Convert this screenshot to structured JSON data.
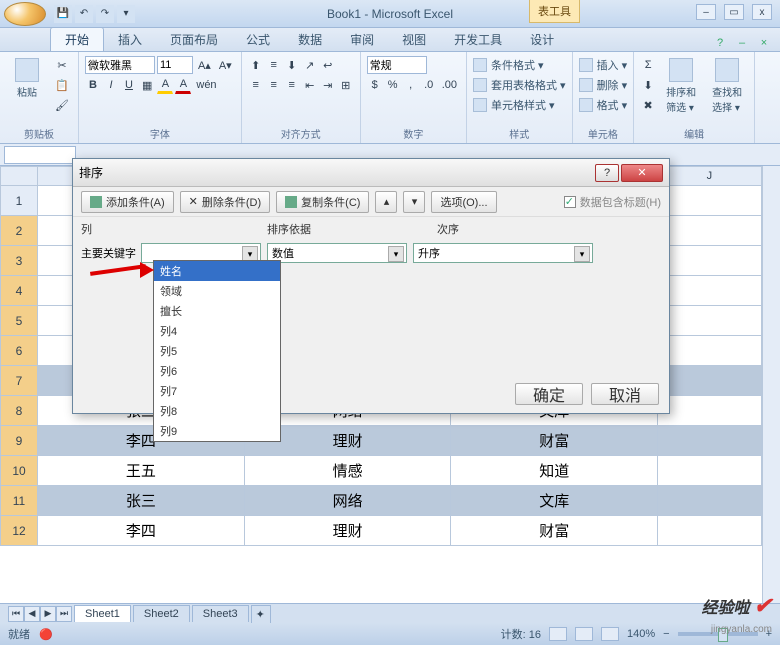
{
  "titlebar": {
    "title": "Book1 - Microsoft Excel",
    "tools_label": "表工具"
  },
  "qat": [
    "save-icon",
    "undo-icon",
    "redo-icon"
  ],
  "tabs": [
    "开始",
    "插入",
    "页面布局",
    "公式",
    "数据",
    "审阅",
    "视图",
    "开发工具",
    "设计"
  ],
  "active_tab": 0,
  "ribbon": {
    "clipboard": {
      "label": "剪贴板",
      "paste": "粘贴"
    },
    "font": {
      "label": "字体",
      "name": "微软雅黑",
      "size": "11"
    },
    "align": {
      "label": "对齐方式"
    },
    "number": {
      "label": "数字",
      "format": "常规"
    },
    "styles": {
      "label": "样式",
      "cond": "条件格式 ▾",
      "table": "套用表格格式 ▾",
      "cell": "单元格样式 ▾"
    },
    "cells": {
      "label": "单元格",
      "insert": "插入 ▾",
      "delete": "删除 ▾",
      "format": "格式 ▾"
    },
    "editing": {
      "label": "编辑",
      "sort": "排序和\n筛选 ▾",
      "find": "查找和\n选择 ▾"
    }
  },
  "namebox": "",
  "dialog": {
    "title": "排序",
    "add": "添加条件(A)",
    "del": "删除条件(D)",
    "copy": "复制条件(C)",
    "options": "选项(O)...",
    "header": "数据包含标题(H)",
    "col_label": "列",
    "sort_on_label": "排序依据",
    "order_label": "次序",
    "primary": "主要关键字",
    "sort_on": "数值",
    "order": "升序",
    "ok": "确定",
    "cancel": "取消",
    "dropdown": [
      "姓名",
      "领域",
      "擅长",
      "列4",
      "列5",
      "列6",
      "列7",
      "列8",
      "列9"
    ]
  },
  "columns": [
    "J"
  ],
  "rows": [
    1,
    2,
    3,
    4,
    5,
    6,
    7,
    8,
    9,
    10,
    11,
    12
  ],
  "data_rows": [
    {
      "a": "张三",
      "b": "网络",
      "c": "文库"
    },
    {
      "a": "李四",
      "b": "理财",
      "c": "财富"
    },
    {
      "a": "王五",
      "b": "情感",
      "c": "知道"
    },
    {
      "a": "张三",
      "b": "网络",
      "c": "文库"
    },
    {
      "a": "李四",
      "b": "理财",
      "c": "财富"
    }
  ],
  "sheets": [
    "Sheet1",
    "Sheet2",
    "Sheet3"
  ],
  "status": {
    "ready": "就绪",
    "count_label": "计数:",
    "count": "16",
    "zoom": "140%"
  },
  "watermark": {
    "text": "经验啦",
    "url": "jingyanla.com"
  }
}
